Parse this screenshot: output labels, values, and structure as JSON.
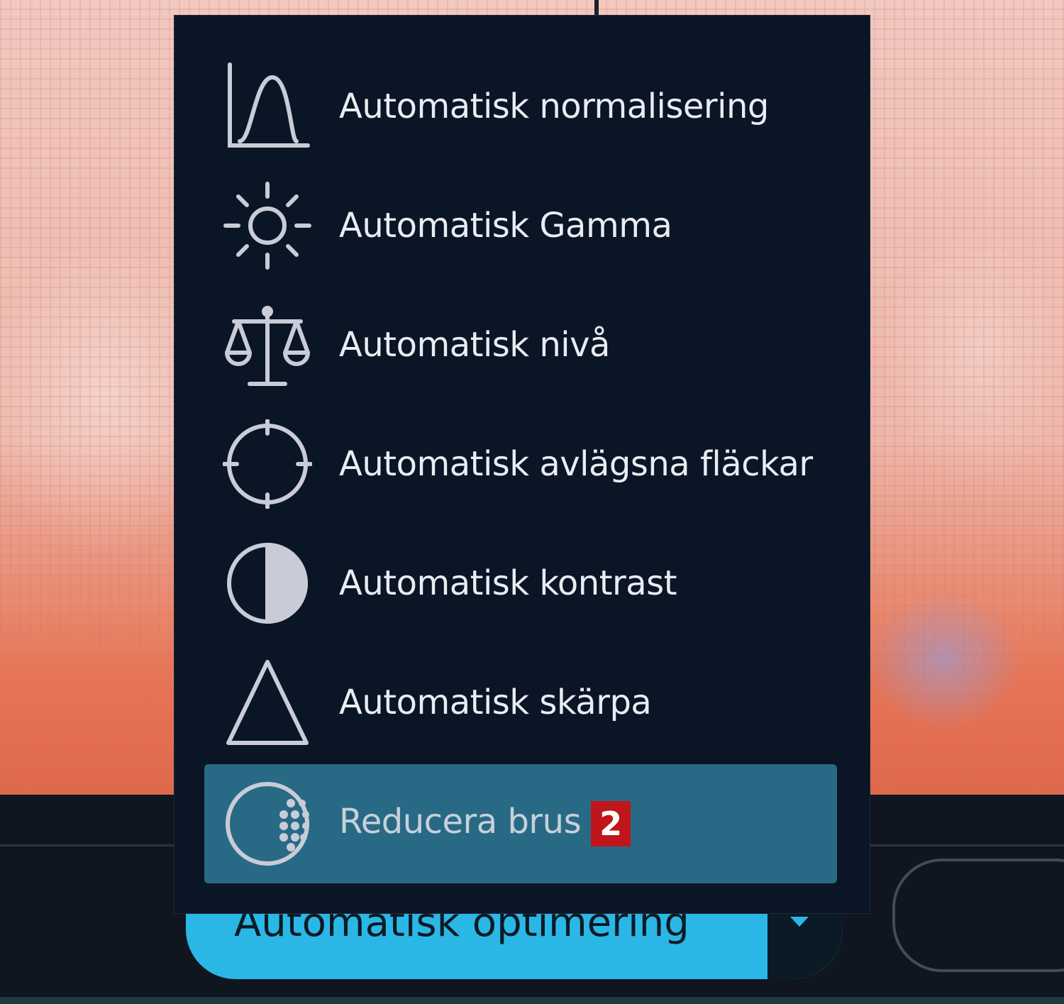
{
  "menu": {
    "items": [
      {
        "label": "Automatisk normalisering",
        "icon": "histogram-curve-icon"
      },
      {
        "label": "Automatisk Gamma",
        "icon": "sun-icon"
      },
      {
        "label": "Automatisk nivå",
        "icon": "balance-scale-icon"
      },
      {
        "label": "Automatisk avlägsna fläckar",
        "icon": "crosshair-icon"
      },
      {
        "label": "Automatisk kontrast",
        "icon": "half-circle-contrast-icon"
      },
      {
        "label": "Automatisk skärpa",
        "icon": "triangle-icon"
      },
      {
        "label": "Reducera brus",
        "icon": "noise-dots-circle-icon",
        "badge": "2",
        "selected": true
      }
    ]
  },
  "toolbar": {
    "auto_optimize_label": "Automatisk optimering"
  },
  "colors": {
    "menu_bg": "#0a1526",
    "selected_bg": "#286a85",
    "accent_button": "#2bb7e6",
    "badge_bg": "#c0151a",
    "icon_stroke": "#c9ccd6"
  }
}
